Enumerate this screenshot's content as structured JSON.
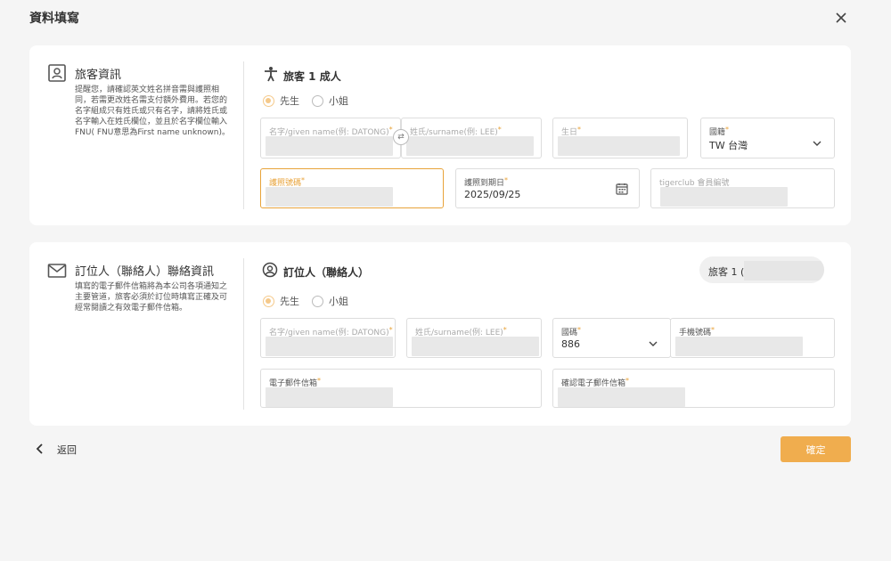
{
  "header": {
    "title": "資料填寫",
    "close_icon": "close-icon"
  },
  "traveler_section": {
    "title": "旅客資訊",
    "description": "提醒您，請確認英文姓名拼音需與護照相同，若需更改姓名需支付額外費用。若您的名字組成只有姓氏或只有名字，請將姓氏或名字輸入在姓氏欄位，並且於名字欄位輸入FNU( FNU意思為First name unknown)。",
    "icon": "passport-card-icon",
    "passenger_title": "旅客 1 成人",
    "passenger_icon": "person-icon",
    "gender_options": [
      "先生",
      "小姐"
    ],
    "gender_selected": "先生",
    "fields": {
      "given_name": {
        "label": "名字/given name(例: DATONG)",
        "value": ""
      },
      "surname": {
        "label": "姓氏/surname(例: LEE)",
        "value": ""
      },
      "birthday": {
        "label": "生日",
        "value": ""
      },
      "nationality": {
        "label": "國籍",
        "value": "TW 台灣"
      },
      "passport_no": {
        "label": "護照號碼",
        "value": ""
      },
      "passport_expiry": {
        "label": "護照到期日",
        "value": "2025/09/25"
      },
      "member_no": {
        "label": "tigerclub 會員編號",
        "value": ""
      }
    },
    "swap_label": "⇄"
  },
  "contact_section": {
    "title": "訂位人（聯絡人）聯絡資訊",
    "description": "填寫的電子郵件信箱將為本公司各項通知之主要管道，旅客必須於訂位時填寫正確及可經常閱讀之有效電子郵件信箱。",
    "icon": "mail-icon",
    "booker_title": "訂位人（聯絡人）",
    "booker_icon": "user-circle-icon",
    "copy_pill": "旅客 1 (",
    "gender_options": [
      "先生",
      "小姐"
    ],
    "gender_selected": "先生",
    "fields": {
      "given_name": {
        "label": "名字/given name(例: DATONG)",
        "value": ""
      },
      "surname": {
        "label": "姓氏/surname(例: LEE)",
        "value": ""
      },
      "country_code": {
        "label": "國碼",
        "value": "886"
      },
      "mobile": {
        "label": "手機號碼",
        "value": ""
      },
      "email": {
        "label": "電子郵件信箱",
        "value": ""
      },
      "email_confirm": {
        "label": "確認電子郵件信箱",
        "value": ""
      }
    }
  },
  "footer": {
    "back_label": "返回",
    "confirm_label": "確定"
  },
  "colors": {
    "accent": "#f0ad4e",
    "focus": "#e8a33a",
    "radio": "#f5c98a"
  }
}
